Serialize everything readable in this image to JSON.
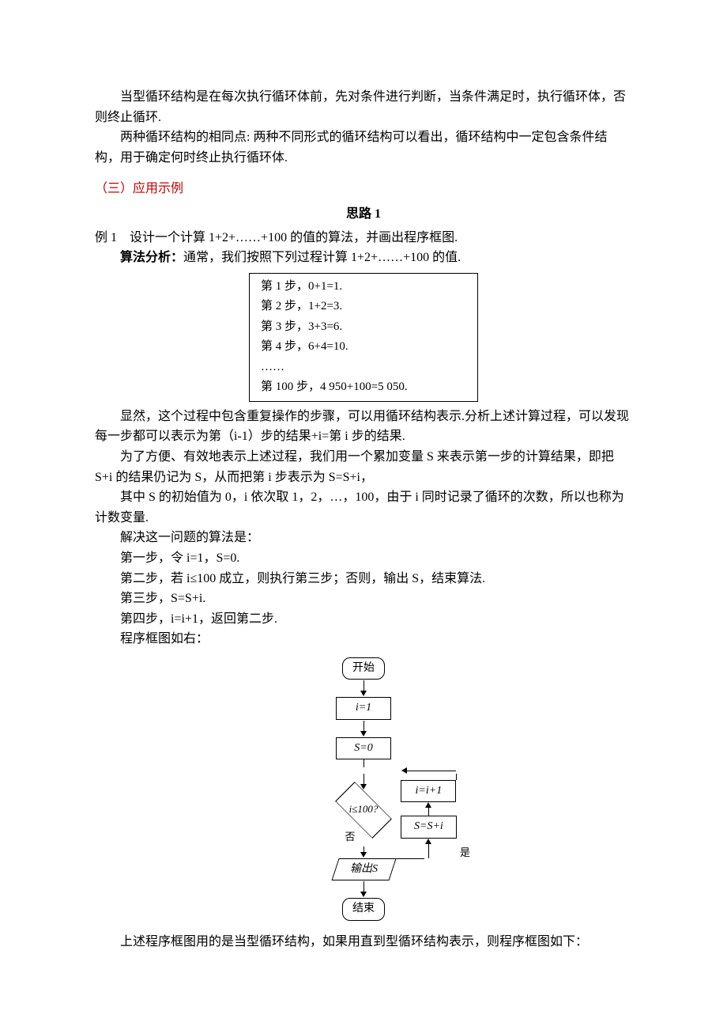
{
  "intro": {
    "p1": "当型循环结构是在每次执行循环体前，先对条件进行判断，当条件满足时，执行循环体，否则终止循环.",
    "p2": "两种循环结构的相同点: 两种不同形式的循环结构可以看出，循环结构中一定包含条件结构，用于确定何时终止执行循环体."
  },
  "section_heading": "（三）应用示例",
  "train_heading": "思路 1",
  "example": {
    "title": "例 1　设计一个计算 1+2+……+100 的值的算法，并画出程序框图.",
    "analysis_label": "算法分析：",
    "analysis_text": "通常，我们按照下列过程计算 1+2+……+100 的值."
  },
  "steps_box": {
    "s1": "第 1 步，0+1=1.",
    "s2": "第 2 步，1+2=3.",
    "s3": "第 3 步，3+3=6.",
    "s4": "第 4 步，6+4=10.",
    "dots": "……",
    "s100": "第 100 步，4 950+100=5 050."
  },
  "body": {
    "p1": "显然，这个过程中包含重复操作的步骤，可以用循环结构表示.分析上述计算过程，可以发现每一步都可以表示为第（i-1）步的结果+i=第 i 步的结果.",
    "p2": "为了方便、有效地表示上述过程，我们用一个累加变量 S 来表示第一步的计算结果，即把 S+i 的结果仍记为 S，从而把第 i 步表示为 S=S+i，",
    "p3": "其中 S 的初始值为 0，i 依次取 1，2，…，100，由于 i 同时记录了循环的次数，所以也称为计数变量.",
    "p4": "解决这一问题的算法是：",
    "step1": "第一步，令 i=1，S=0.",
    "step2": "第二步，若 i≤100 成立，则执行第三步；否则，输出 S，结束算法.",
    "step3": "第三步，S=S+i.",
    "step4": "第四步，i=i+1，返回第二步.",
    "p5": "程序框图如右："
  },
  "flowchart": {
    "start": "开始",
    "init_i": "i=1",
    "init_s": "S=0",
    "inc_i": "i=i+1",
    "acc": "S=S+i",
    "cond": "i≤100?",
    "yes": "是",
    "no": "否",
    "output": "输出S",
    "end": "结束"
  },
  "conclusion": "上述程序框图用的是当型循环结构，如果用直到型循环结构表示，则程序框图如下："
}
